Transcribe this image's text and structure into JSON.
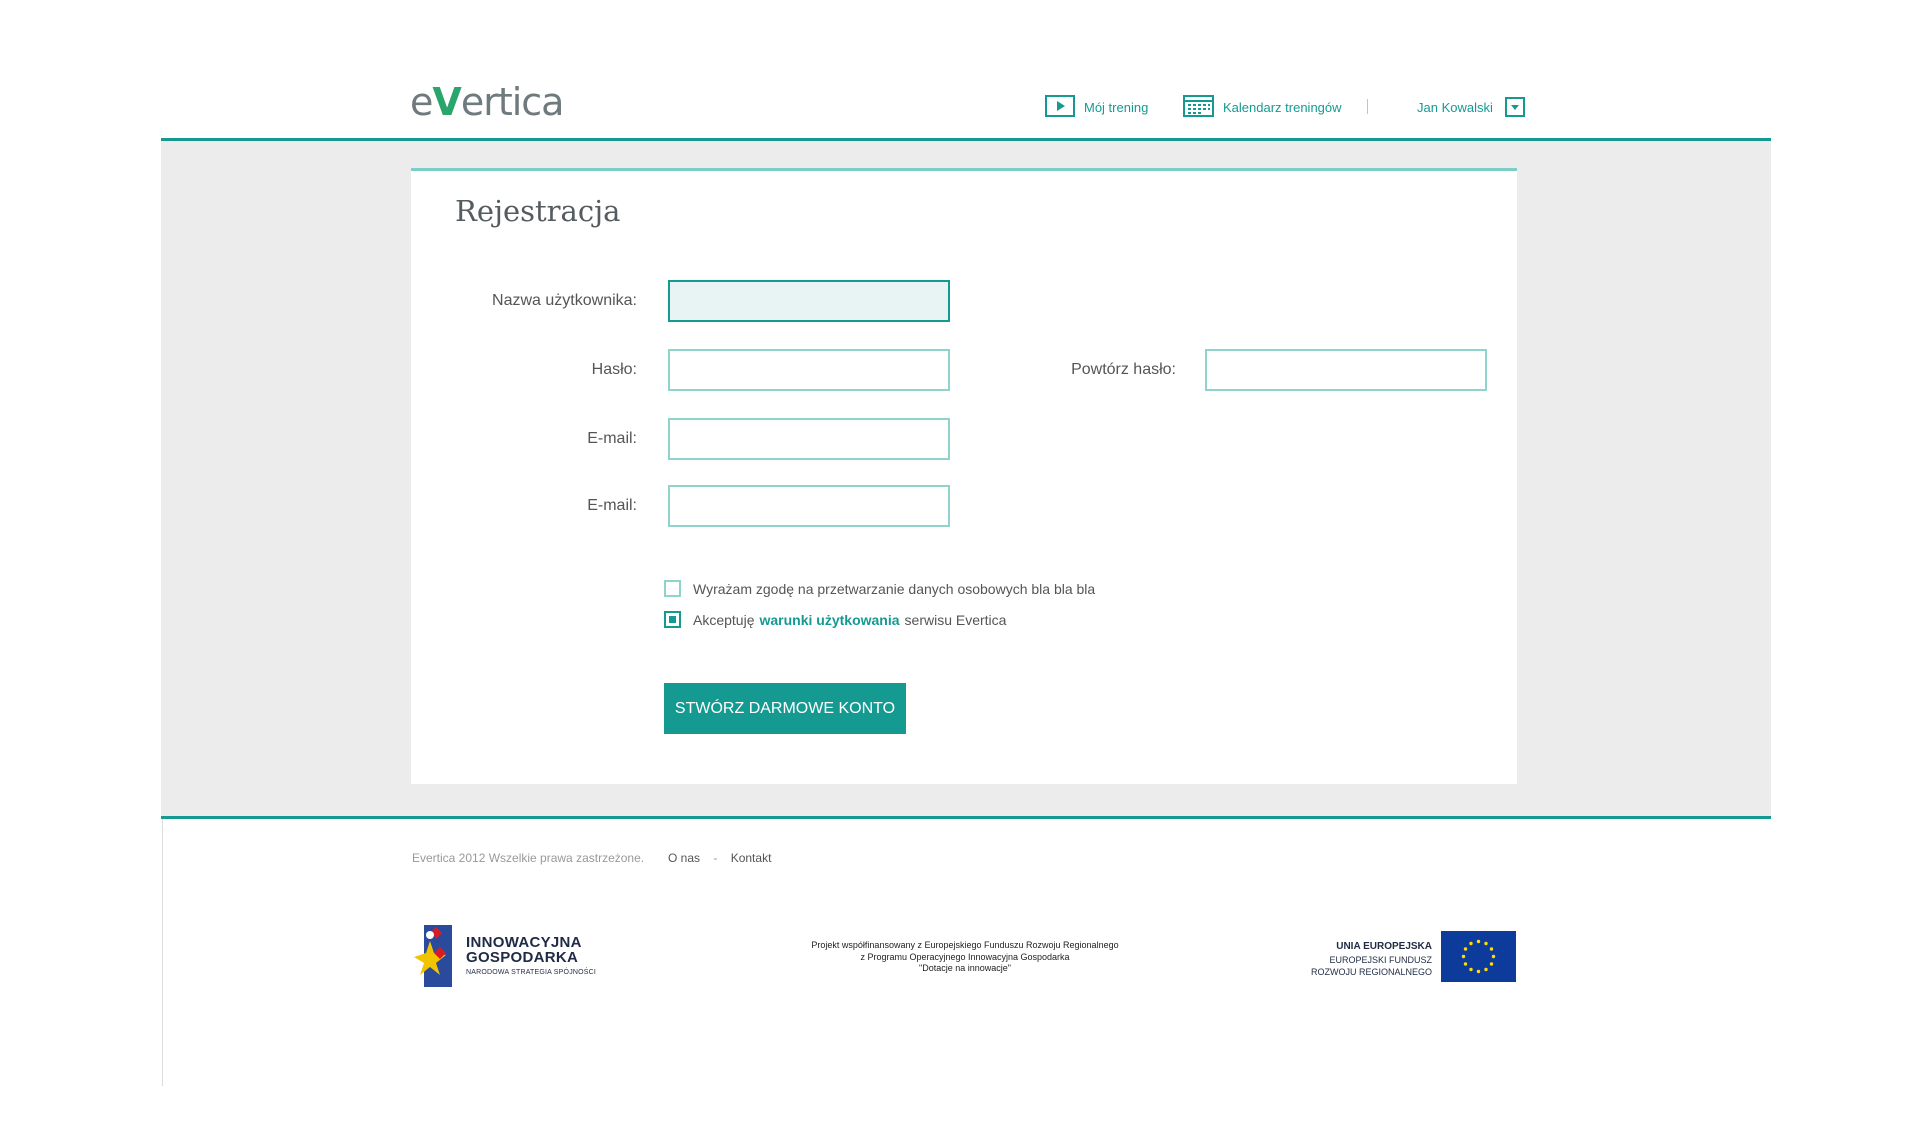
{
  "header": {
    "logo_prefix": "e",
    "logo_v": "V",
    "logo_suffix": "ertica",
    "nav": {
      "training_label": "Mój trening",
      "calendar_label": "Kalendarz treningów",
      "user_name": "Jan Kowalski"
    }
  },
  "registration": {
    "title": "Rejestracja",
    "username_label": "Nazwa użytkownika:",
    "username_value": "",
    "password_label": "Hasło:",
    "password_value": "",
    "repeat_password_label": "Powtórz hasło:",
    "repeat_password_value": "",
    "email_label": "E-mail:",
    "email_value": "",
    "email2_label": "E-mail:",
    "email2_value": "",
    "consent_label": "Wyrażam zgodę na przetwarzanie danych osobowych bla bla bla",
    "consent_checked": false,
    "terms_prefix": "Akceptuję",
    "terms_link": "warunki użytkowania",
    "terms_suffix": "serwisu Evertica",
    "terms_checked": true,
    "submit_label": "STWÓRZ DARMOWE KONTO"
  },
  "footer": {
    "copyright": "Evertica 2012 Wszelkie prawa zastrzeżone.",
    "about_link": "O nas",
    "separator": "-",
    "contact_link": "Kontakt",
    "ig_line1": "INNOWACYJNA",
    "ig_line2": "GOSPODARKA",
    "ig_sub": "NARODOWA STRATEGIA SPÓJNOŚCI",
    "project_line1": "Projekt współfinansowany z Europejskiego Funduszu Rozwoju Regionalnego",
    "project_line2": "z Programu Operacyjnego Innowacyjna Gospodarka",
    "project_line3": "\"Dotacje na innowacje\"",
    "eu_line1": "UNIA EUROPEJSKA",
    "eu_line2": "EUROPEJSKI FUNDUSZ",
    "eu_line3": "ROZWOJU REGIONALNEGO"
  },
  "icons": {
    "play": "play-icon",
    "calendar": "calendar-icon",
    "dropdown": "chevron-down-icon"
  },
  "colors": {
    "accent": "#159a92",
    "accent_light": "#8ed3cc",
    "band": "#ececec",
    "eu_blue": "#0d3b9c",
    "eu_star": "#ffdd00"
  }
}
